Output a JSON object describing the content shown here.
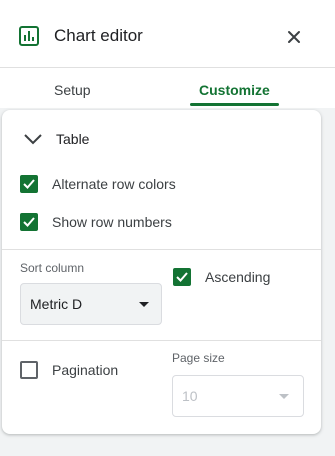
{
  "header": {
    "title": "Chart editor",
    "icon": "bar-chart-icon",
    "close_icon": "close-icon"
  },
  "tabs": [
    {
      "label": "Setup",
      "active": false
    },
    {
      "label": "Customize",
      "active": true
    }
  ],
  "accent_color": "#137333",
  "section": {
    "title": "Table",
    "expanded": true,
    "options": {
      "alternate_row_colors": {
        "label": "Alternate row colors",
        "checked": true
      },
      "show_row_numbers": {
        "label": "Show row numbers",
        "checked": true
      }
    },
    "sort": {
      "label": "Sort column",
      "value": "Metric D",
      "ascending": {
        "label": "Ascending",
        "checked": true
      }
    },
    "pagination": {
      "label": "Pagination",
      "checked": false,
      "page_size_label": "Page size",
      "page_size_value": "10"
    }
  }
}
